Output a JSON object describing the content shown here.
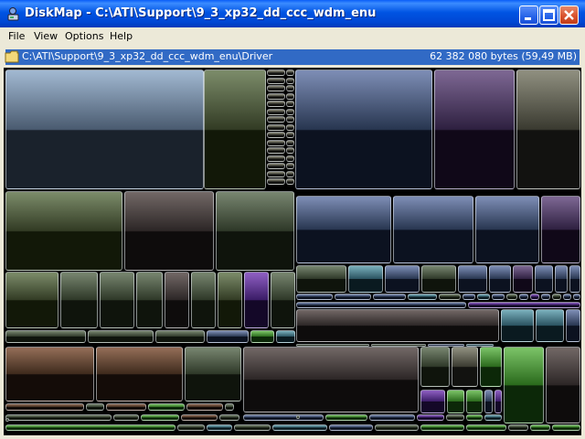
{
  "window": {
    "title": "DiskMap - C:\\ATI\\Support\\9_3_xp32_dd_ccc_wdm_enu",
    "buttons": [
      "minimize",
      "maximize",
      "close"
    ]
  },
  "menu": {
    "items": [
      "File",
      "View",
      "Options",
      "Help"
    ]
  },
  "pathbar": {
    "path_base": "C:\\ATI\\Support\\9_3_xp32_dd_ccc_wdm_enu\\",
    "path_leaf": "Driver",
    "size": "62 382 080 bytes (59,49 MB)"
  },
  "colors": {
    "titlebar": "#0054e3",
    "selection": "#316ac5",
    "menubar": "#ece9d8",
    "treemap_bg": "#000000"
  },
  "icons": [
    "app-icon",
    "folder-icon",
    "minimize-icon",
    "maximize-icon",
    "close-icon"
  ]
}
